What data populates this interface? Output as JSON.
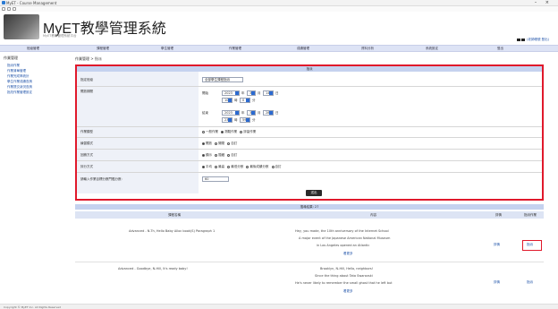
{
  "window": {
    "title": "MyET - Course Management",
    "controls": "– ×"
  },
  "header": {
    "brand": "MyET教學管理系統",
    "subtitle": "MyET教學管理系統平台",
    "right_link": "(老師帳號 登出)"
  },
  "nav": {
    "items": [
      "班級管理",
      "課程管理",
      "學生管理",
      "作業管理",
      "成績管理",
      "資料分析",
      "系統設定",
      "登出"
    ]
  },
  "sidebar": {
    "heading": "作業管理",
    "items": [
      "指派作業",
      "作業清單管理",
      "作業完成率統計",
      "學生作業成績查詢",
      "作業提交狀況查詢",
      "批改作業管理設定"
    ]
  },
  "breadcrumb": {
    "parent": "作業管理",
    "current": "指派"
  },
  "form": {
    "header": "指派",
    "labels": {
      "class": "指定班級",
      "period": "開放期間",
      "type": "作業類型",
      "practice": "練習模式",
      "feedback": "回饋方式",
      "score": "評分方式",
      "target": "請輸入作業目標分數門檻分數:"
    },
    "class_value": "全部學生課程指派",
    "start_label": "開始",
    "end_label": "結束",
    "start": {
      "year": "2023",
      "month": "3",
      "day": "14",
      "hour": "10",
      "minute": "0"
    },
    "end": {
      "year": "2023",
      "month": "3",
      "day": "28",
      "hour": "23",
      "minute": "59"
    },
    "unit_year": "年",
    "unit_month": "月",
    "unit_day": "日",
    "unit_hour": "時",
    "unit_min": "分",
    "type_opts": [
      "一般作業",
      "測驗作業",
      "評量作業"
    ],
    "practice_opts": [
      "開放",
      "關閉",
      "自訂"
    ],
    "feedback_opts": [
      "顯示",
      "隱藏",
      "自訂"
    ],
    "score_opts": [
      "平均",
      "最高",
      "最低分數",
      "最後成績分數",
      "自訂"
    ],
    "target_value": "60",
    "submit": "送出"
  },
  "results": {
    "header": "搜尋結果: 27",
    "columns": [
      "課程名稱",
      "內容",
      "詳情",
      "指派作業"
    ],
    "rows": [
      {
        "course": "Advanced - N-Th, Hello Baby Alloc book(S) Paragraph 1",
        "content": [
          "Hey, you made, the 10th anniversary of the Internet School",
          "A major event of the Japanese American National Museum",
          "in Los Angeles opened an Atlantic",
          "看更多"
        ],
        "detail": "詳情",
        "assign": "指派"
      },
      {
        "course": "Advanced - Goodbye, N-Hill, It's ready baby!",
        "content": [
          "Brooklyn, N-Hill, Hello, neighbors!",
          "Since the thing about Tata Swarovski",
          "He's never likely to remember the small ghost that he left but",
          "看更多"
        ],
        "detail": "詳情",
        "assign": "指派"
      }
    ]
  },
  "status": {
    "text": "Copyright © MyET Inc. All Rights Reserved"
  },
  "colors": {
    "accent": "#e0192b",
    "nav_bg": "#dde3f5",
    "table_head": "#c5d2ef"
  }
}
